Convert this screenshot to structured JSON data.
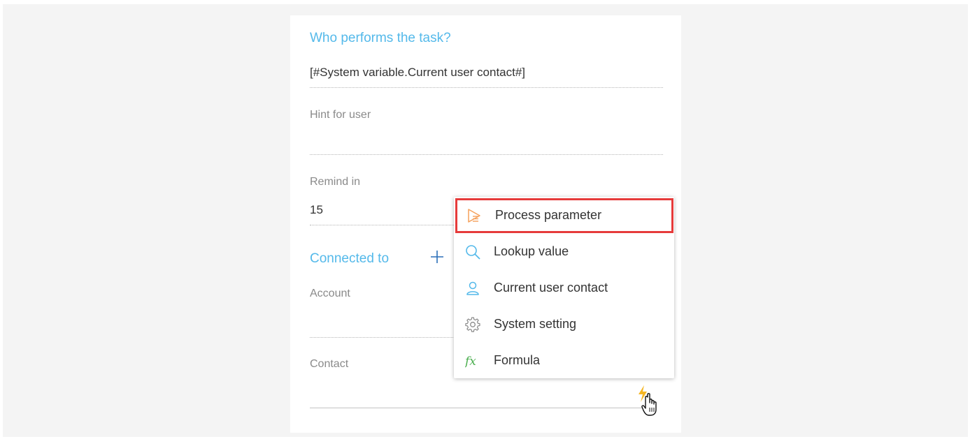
{
  "task": {
    "performer_title": "Who performs the task?",
    "performer_value": "[#System variable.Current user contact#]",
    "hint_label": "Hint for user",
    "hint_value": "",
    "remind_label": "Remind in",
    "remind_value": "15",
    "connected_title": "Connected to",
    "account_label": "Account",
    "account_value": "",
    "contact_label": "Contact",
    "contact_value": ""
  },
  "menu": {
    "items": [
      {
        "label": "Process parameter",
        "icon": "process-parameter-icon",
        "color": "#f5a05a",
        "highlighted": true
      },
      {
        "label": "Lookup value",
        "icon": "search-icon",
        "color": "#54b9ea",
        "highlighted": false
      },
      {
        "label": "Current user contact",
        "icon": "user-icon",
        "color": "#54b9ea",
        "highlighted": false
      },
      {
        "label": "System setting",
        "icon": "gear-icon",
        "color": "#8a8a8a",
        "highlighted": false
      },
      {
        "label": "Formula",
        "icon": "formula-icon",
        "color": "#4caf50",
        "highlighted": false
      }
    ]
  },
  "colors": {
    "accent": "#54b9ea",
    "highlight_border": "#e63b3b",
    "lightning": "#f5b623"
  }
}
